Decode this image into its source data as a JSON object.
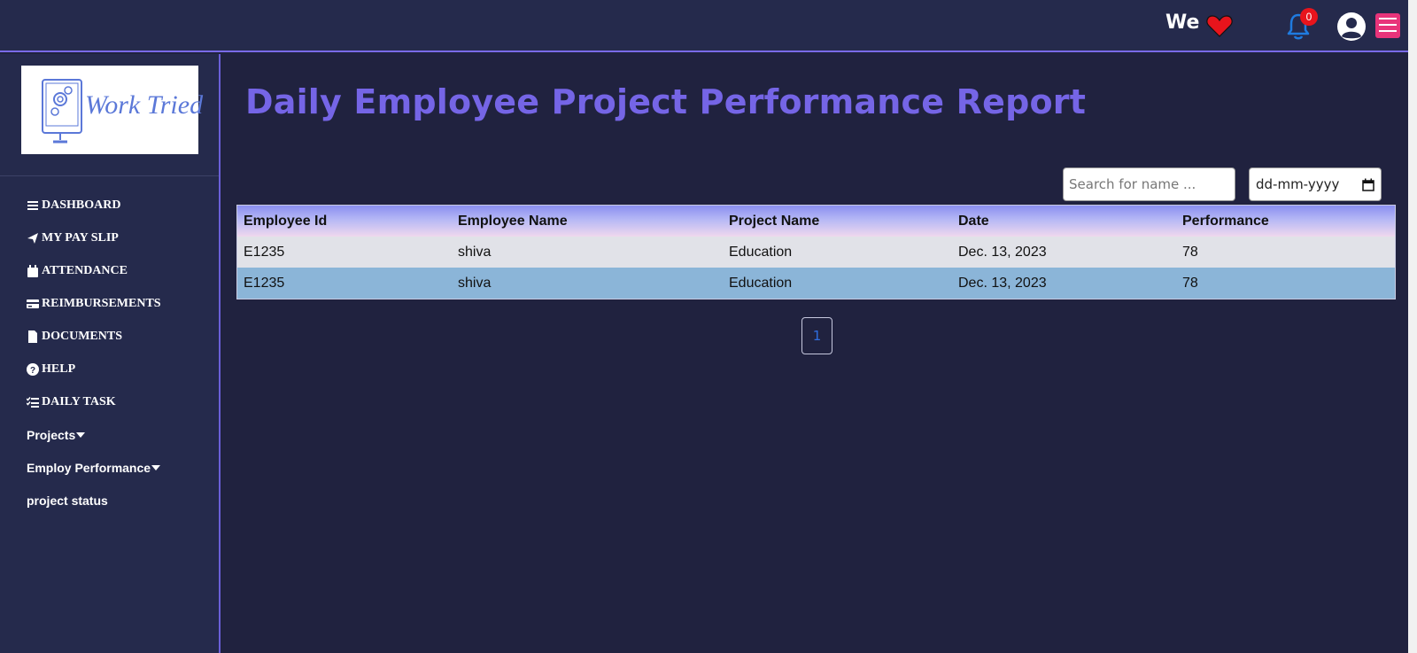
{
  "header": {
    "greeting": "We",
    "notification_count": "0",
    "colors": {
      "heart": "#e8141c",
      "bell": "#1f7be0",
      "menu": "#e8347a"
    }
  },
  "sidebar": {
    "logo_text": "Work Tried",
    "items": [
      {
        "label": "DASHBOARD",
        "icon": "bars-icon"
      },
      {
        "label": "MY PAY SLIP",
        "icon": "paper-plane-icon"
      },
      {
        "label": "ATTENDANCE",
        "icon": "calendar-icon"
      },
      {
        "label": "REIMBURSEMENTS",
        "icon": "credit-card-icon"
      },
      {
        "label": "DOCUMENTS",
        "icon": "file-icon"
      },
      {
        "label": "HELP",
        "icon": "question-circle-icon"
      },
      {
        "label": "DAILY TASK",
        "icon": "list-check-icon"
      },
      {
        "label": "Projects",
        "icon": "caret-down-icon"
      },
      {
        "label": "Employ Performance",
        "icon": "caret-down-icon"
      },
      {
        "label": "project status"
      }
    ]
  },
  "main": {
    "title": "Daily Employee Project Performance Report",
    "search": {
      "placeholder": "Search for name ..."
    },
    "date_filter": {
      "placeholder": "dd-mm-yyyy"
    },
    "table": {
      "columns": [
        "Employee Id",
        "Employee Name",
        "Project Name",
        "Date",
        "Performance"
      ],
      "rows": [
        [
          "E1235",
          "shiva",
          "Education",
          "Dec. 13, 2023",
          "78"
        ],
        [
          "E1235",
          "shiva",
          "Education",
          "Dec. 13, 2023",
          "78"
        ]
      ]
    },
    "pagination": {
      "current_page": "1"
    }
  }
}
